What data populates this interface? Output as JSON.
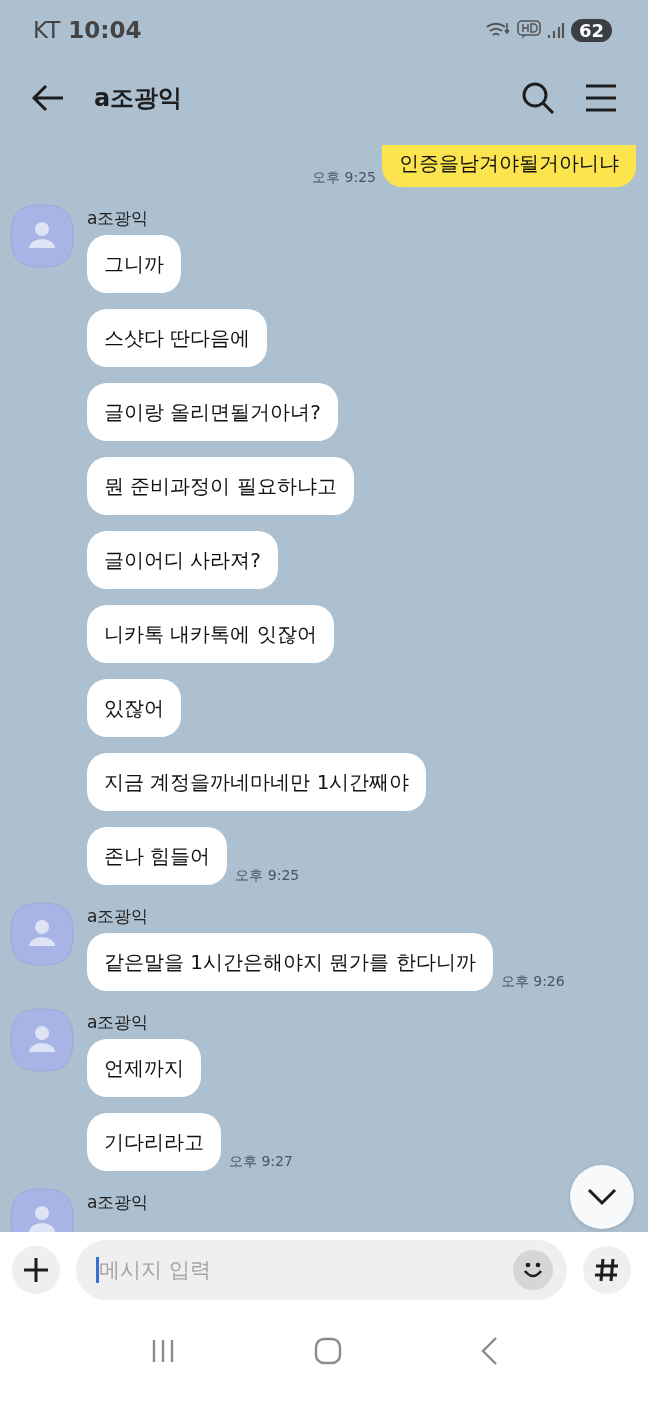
{
  "status_bar": {
    "carrier": "KT",
    "time": "10:04",
    "battery": "62"
  },
  "header": {
    "title": "a조광익"
  },
  "messages": [
    {
      "kind": "sent",
      "bubbles": [
        "인증을남겨야될거아니냐"
      ],
      "time": "오후 9:25"
    },
    {
      "kind": "received",
      "sender": "a조광익",
      "bubbles": [
        "그니까",
        "스샷다 딴다음에",
        "글이랑 올리면될거아녀?",
        "뭔 준비과정이 필요하냐고",
        "글이어디 사라져?",
        "니카톡 내카톡에 잇잖어",
        "있잖어",
        "지금 계정을까네마네만 1시간째야",
        "존나 힘들어"
      ],
      "time": "오후 9:25"
    },
    {
      "kind": "received",
      "sender": "a조광익",
      "bubbles": [
        "같은말을 1시간은해야지 뭔가를 한다니까"
      ],
      "time": "오후 9:26"
    },
    {
      "kind": "received",
      "sender": "a조광익",
      "bubbles": [
        "언제까지",
        "기다리라고"
      ],
      "time": "오후 9:27"
    },
    {
      "kind": "received",
      "sender": "a조광익"
    }
  ],
  "composer": {
    "placeholder": "메시지 입력"
  }
}
